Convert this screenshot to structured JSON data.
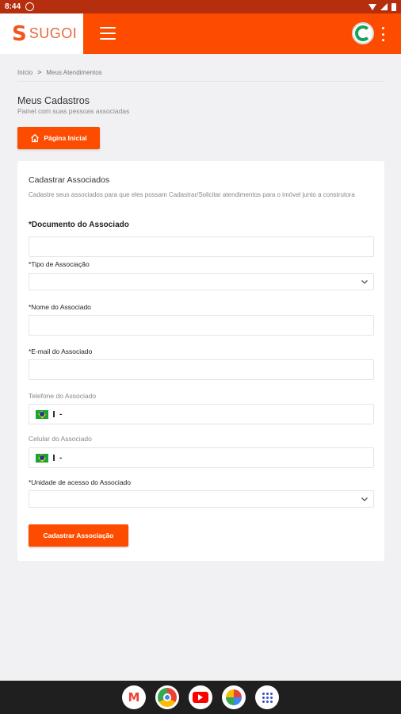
{
  "status_bar": {
    "time": "8:44"
  },
  "header": {
    "logo_text": "SUGOI",
    "logo_mark": "S"
  },
  "breadcrumb": {
    "home": "Início",
    "current": "Meus Atendimentos",
    "separator": ">"
  },
  "page": {
    "title": "Meus Cadastros",
    "subtitle": "Painel com suas pessoas associadas",
    "home_button_label": "Página Inicial"
  },
  "form": {
    "title": "Cadastrar Associados",
    "description": "Cadastre seus associados para que eles possam Cadastrar/Solicitar atendimentos para o imóvel junto a construtora",
    "fields": {
      "documento": {
        "label": "*Documento do Associado",
        "value": ""
      },
      "tipo": {
        "label": "*Tipo de Associação",
        "value": ""
      },
      "nome": {
        "label": "*Nome do Associado",
        "value": ""
      },
      "email": {
        "label": "*E-mail do Associado",
        "value": ""
      },
      "telefone": {
        "label": "Telefone do Associado",
        "value": "-"
      },
      "celular": {
        "label": "Celular do Associado",
        "value": "-"
      },
      "unidade": {
        "label": "*Unidade de acesso do Associado",
        "value": ""
      }
    },
    "submit_label": "Cadastrar Associação"
  },
  "dock": {
    "gmail_letter": "M"
  },
  "colors": {
    "brand": "#fd4c00",
    "status_bar": "#b52f0e",
    "background": "#f1f1f3"
  },
  "icons": [
    "menu-icon",
    "kebab-menu-icon",
    "home-icon",
    "chevron-down-icon",
    "brazil-flag-icon"
  ]
}
